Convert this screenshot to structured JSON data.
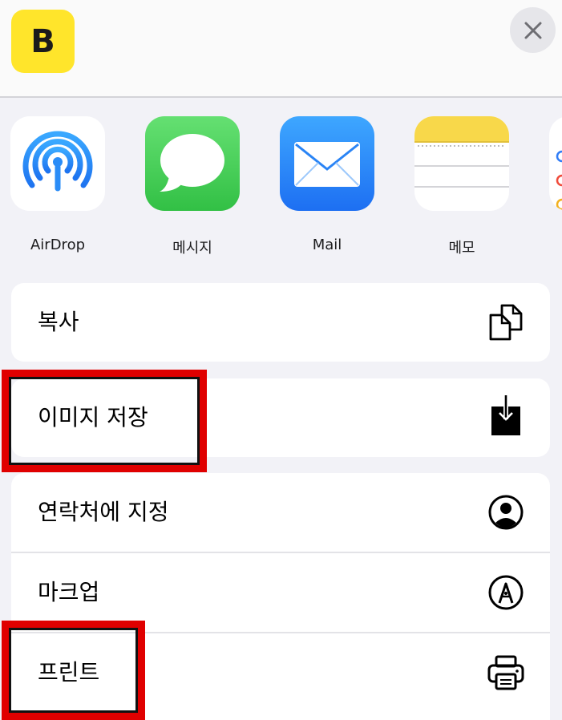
{
  "header": {
    "app_badge_letter": "B",
    "close_glyph": "✕"
  },
  "share_apps": [
    {
      "label": "AirDrop",
      "icon": "airdrop-icon"
    },
    {
      "label": "메시지",
      "icon": "messages-icon"
    },
    {
      "label": "Mail",
      "icon": "mail-icon"
    },
    {
      "label": "메모",
      "icon": "notes-icon"
    }
  ],
  "actions": {
    "copy": {
      "label": "복사",
      "icon": "copy-icon"
    },
    "save_image": {
      "label": "이미지 저장",
      "icon": "save-image-icon"
    },
    "assign_contact": {
      "label": "연락처에 지정",
      "icon": "contact-icon"
    },
    "markup": {
      "label": "마크업",
      "icon": "markup-icon"
    },
    "print": {
      "label": "프린트",
      "icon": "print-icon"
    }
  },
  "colors": {
    "highlight": "#e00000",
    "app_badge": "#ffe52b",
    "background": "#f2f2f7"
  }
}
